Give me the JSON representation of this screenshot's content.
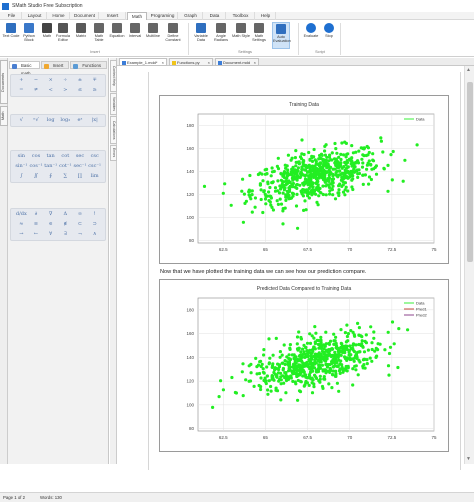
{
  "titlebar": {
    "title": "SMath Studio Free Subscription",
    "tabs": [
      "File",
      "Layout",
      "Home",
      "Document",
      "Insert",
      "Math",
      "Programing",
      "Graph",
      "Data",
      "Toolbox",
      "Help"
    ],
    "active_tab": "Math"
  },
  "ribbon": {
    "buttons": [
      {
        "label": "Text Code",
        "icon": "text-code-icon",
        "color": "#2f6fbf"
      },
      {
        "label": "Python Block",
        "icon": "python-icon",
        "color": "#3a78c9"
      },
      {
        "label": "Math",
        "icon": "math-icon",
        "color": "#444444"
      },
      {
        "label": "Formula Editor",
        "icon": "formula-icon",
        "color": "#555555"
      },
      {
        "label": "Matrix",
        "icon": "matrix-icon",
        "color": "#5a5a5a"
      },
      {
        "label": "Math Table",
        "icon": "table-icon",
        "color": "#666666"
      },
      {
        "label": "Equation",
        "icon": "equation-icon",
        "color": "#666666"
      },
      {
        "label": "Interval",
        "icon": "interval-icon",
        "color": "#666666"
      },
      {
        "label": "Multiline",
        "icon": "multiline-icon",
        "color": "#666666"
      },
      {
        "label": "Define Constant",
        "icon": "constant-icon",
        "color": "#666666"
      },
      {
        "label": "Variable Data",
        "icon": "variable-icon",
        "color": "#2f6fbf"
      },
      {
        "label": "Angle Radians",
        "icon": "angle-icon",
        "color": "#666666"
      },
      {
        "label": "Math Style",
        "icon": "style-icon",
        "color": "#666666"
      },
      {
        "label": "Math Settings",
        "icon": "settings-icon",
        "color": "#666666"
      },
      {
        "label": "Auto Evaluation",
        "icon": "auto-eval-icon",
        "color": "#2f6fbf"
      },
      {
        "label": "Evaluate",
        "icon": "play-icon",
        "color": "#1e6fd0"
      },
      {
        "label": "Stop",
        "icon": "stop-icon",
        "color": "#1e6fd0"
      }
    ],
    "groups": [
      "Insert",
      "Settings",
      "Script"
    ]
  },
  "left_strip": {
    "tabs": [
      "Documents",
      "Math"
    ]
  },
  "sidebar": {
    "tabs": [
      {
        "label": "Basic math",
        "icon": "basic-math-icon"
      },
      {
        "label": "Insert",
        "icon": "insert-icon"
      },
      {
        "label": "Functions",
        "icon": "functions-icon"
      }
    ],
    "symbol_groups": [
      [
        "+",
        "−",
        "×",
        "÷",
        "±",
        "∓"
      ],
      [
        "=",
        "≠",
        "<",
        ">",
        "≤",
        "≥"
      ],
      [
        "√",
        "ⁿ√",
        "log",
        "log₂",
        "eˣ",
        "|x|"
      ],
      [
        "sin",
        "cos",
        "tan",
        "cot",
        "sec",
        "csc"
      ],
      [
        "sin⁻¹",
        "cos⁻¹",
        "tan⁻¹",
        "cot⁻¹",
        "sec⁻¹",
        "csc⁻¹"
      ],
      [
        "∫",
        "∬",
        "∮",
        "∑",
        "∏",
        "lim"
      ],
      [
        "d/dx",
        "∂",
        "∇",
        "Δ",
        "∞",
        "!"
      ],
      [
        "≈",
        "≡",
        "∈",
        "∉",
        "⊂",
        "⊃"
      ],
      [
        "→",
        "←",
        "∀",
        "∃",
        "¬",
        "∧"
      ]
    ]
  },
  "vertical_panel": {
    "tabs": [
      "Context Help",
      "Variables",
      "Calculations",
      "Errors"
    ]
  },
  "doc_tabs": [
    {
      "label": "Example_1.mdd*",
      "active": true
    },
    {
      "label": "Functions.py",
      "active": false
    },
    {
      "label": "Document.mdd",
      "active": false
    }
  ],
  "document": {
    "paragraph": "Now that we have plotted the training data we can see how our prediction compare."
  },
  "chart_data": [
    {
      "type": "scatter",
      "title": "Training Data",
      "xlim": [
        61,
        75
      ],
      "ylim": [
        78,
        190
      ],
      "xticks": [
        "62.5",
        "65",
        "67.5",
        "70",
        "72.5",
        "75"
      ],
      "yticks": [
        "80",
        "100",
        "120",
        "140",
        "160",
        "180"
      ],
      "series": [
        {
          "name": "Data",
          "color": "#22ee22",
          "cluster": {
            "x_mean": 68,
            "y_mean": 136,
            "x_sd": 1.9,
            "y_sd": 12,
            "corr": 0.5,
            "n": 650
          }
        }
      ],
      "legend": "top-right",
      "grid": true
    },
    {
      "type": "scatter",
      "title": "Predicted Data Compared to Training Data",
      "xlim": [
        61,
        75
      ],
      "ylim": [
        78,
        190
      ],
      "xticks": [
        "62.5",
        "65",
        "67.5",
        "70",
        "72.5",
        "75"
      ],
      "yticks": [
        "80",
        "100",
        "120",
        "140",
        "160",
        "180"
      ],
      "series": [
        {
          "name": "Data",
          "color": "#22ee22",
          "cluster": {
            "x_mean": 68,
            "y_mean": 136,
            "x_sd": 1.9,
            "y_sd": 12,
            "corr": 0.5,
            "n": 650
          }
        },
        {
          "name": "Pred1",
          "color": "#c0392b"
        },
        {
          "name": "Pred2",
          "color": "#7f2f7f"
        }
      ],
      "legend": "top-right",
      "grid": true
    }
  ],
  "statusbar": {
    "page": "Page 1 of 2",
    "words": "Words: 130"
  }
}
